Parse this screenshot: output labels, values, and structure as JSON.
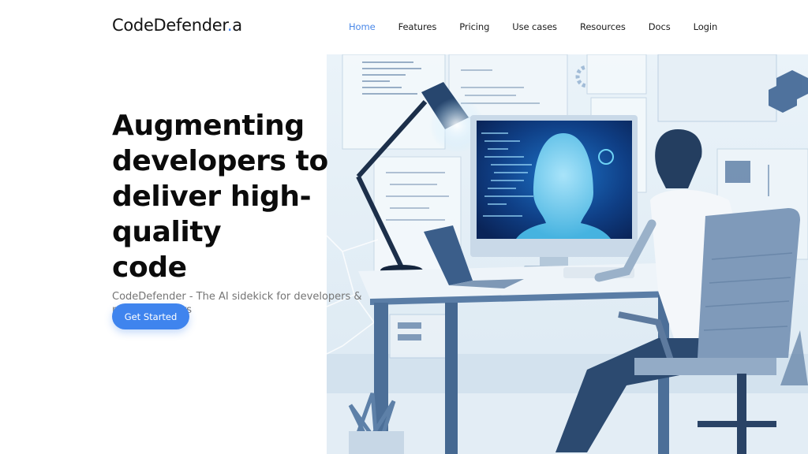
{
  "brand": {
    "name": "CodeDefender",
    "suffix_dot": ".",
    "suffix": "a",
    "accent_color": "#3b82f6"
  },
  "nav": {
    "items": [
      {
        "label": "Home",
        "active": true
      },
      {
        "label": "Features",
        "active": false
      },
      {
        "label": "Pricing",
        "active": false
      },
      {
        "label": "Use cases",
        "active": false
      },
      {
        "label": "Resources",
        "active": false
      },
      {
        "label": "Docs",
        "active": false
      },
      {
        "label": "Login",
        "active": false
      }
    ],
    "active_color": "#4a88e8"
  },
  "hero": {
    "headline_lines": [
      "Augmenting",
      "developers to",
      "deliver high-quality",
      "code"
    ],
    "subtitle": "CodeDefender - The AI sidekick for developers & non-developers",
    "cta_label": "Get Started",
    "cta_color": "#3f84ee",
    "illustration": {
      "description": "Developer at desk with monitor showing AI head and code, desk lamp, laptop, chair, plant, wall charts",
      "palette": [
        "#e8f1f8",
        "#5b7fa6",
        "#2d4d78",
        "#0f2c5c",
        "#6fd3f5"
      ]
    }
  }
}
